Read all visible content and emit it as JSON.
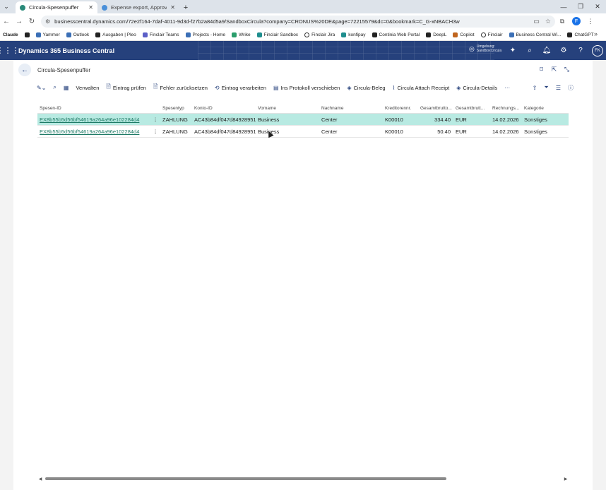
{
  "browser": {
    "tabs": [
      {
        "label": "Circula-Spesenpuffer",
        "active": true
      },
      {
        "label": "Expense export, Approve & Cu",
        "active": false
      }
    ],
    "url": "businesscentral.dynamics.com/72e2f164-7daf-4011-9d3d-f27b2a84d5a9/SandboxCircula?company=CRONUS%20DE&page=72215579&dc=0&bookmark=C_G-xNBACH3w",
    "profile_initial": "F",
    "bookmarks": [
      {
        "label": "Claude",
        "icon": "claude-icon"
      },
      {
        "label": "",
        "icon": "apps-grid-icon"
      },
      {
        "label": "Yammer",
        "icon": "yammer-icon"
      },
      {
        "label": "Outlook",
        "icon": "outlook-icon"
      },
      {
        "label": "Ausgaben | Pleo",
        "icon": "pleo-icon"
      },
      {
        "label": "Finclair Teams",
        "icon": "teams-icon"
      },
      {
        "label": "Projects - Home",
        "icon": "projects-icon"
      },
      {
        "label": "Wrike",
        "icon": "wrike-icon"
      },
      {
        "label": "Finclair Sandbox",
        "icon": "finclair-icon"
      },
      {
        "label": "Finclair Jira",
        "icon": "jira-icon"
      },
      {
        "label": "konfipay",
        "icon": "konfipay-icon"
      },
      {
        "label": "Continia Web Portal",
        "icon": "continia-icon"
      },
      {
        "label": "DeepL",
        "icon": "deepl-icon"
      },
      {
        "label": "Copilot",
        "icon": "copilot-icon"
      },
      {
        "label": "Finclair",
        "icon": "finclair-ring-icon"
      },
      {
        "label": "Business Central Wi...",
        "icon": "business-central-icon"
      },
      {
        "label": "ChatGPT",
        "icon": "chatgpt-icon"
      }
    ]
  },
  "app": {
    "title": "Dynamics 365 Business Central",
    "environment_line1": "Umgebung:",
    "environment_line2": "SandboxCircula",
    "user_initials": "FK"
  },
  "page": {
    "title": "Circula-Spesenpuffer"
  },
  "actions": [
    {
      "label": "Verwalten",
      "icon": ""
    },
    {
      "label": "Eintrag prüfen",
      "icon": "check-document-icon"
    },
    {
      "label": "Fehler zurücksetzen",
      "icon": "reset-document-icon"
    },
    {
      "label": "Eintrag verarbeiten",
      "icon": "process-icon"
    },
    {
      "label": "Ins Protokoll verschieben",
      "icon": "log-icon"
    },
    {
      "label": "Circula-Beleg",
      "icon": "circula-icon"
    },
    {
      "label": "Circula Attach Receipt",
      "icon": "paperclip-icon"
    },
    {
      "label": "Circula-Details",
      "icon": "circula-details-icon"
    }
  ],
  "table": {
    "columns": [
      "Spesen-ID",
      "",
      "Spesentyp",
      "Konto-ID",
      "Vorname",
      "Nachname",
      "Kreditorennr.",
      "Gesamtbrutto...",
      "Gesamtbrutt...",
      "Rechnungs...",
      "Kategorie"
    ],
    "rows": [
      {
        "id": "EX8b55b5d56bf54619a264a96e102284d4",
        "typ": "ZAHLUNG",
        "konto": "AC43b84df047d84928951...",
        "vorname": "Business",
        "nachname": "Center",
        "kreditor": "K00010",
        "betrag": "334.40",
        "waehrung": "EUR",
        "datum": "14.02.2026",
        "kategorie": "Sonstiges",
        "selected": true
      },
      {
        "id": "EX8b55b5d56bf54619a264a96e102284d4",
        "typ": "ZAHLUNG",
        "konto": "AC43b84df047d84928951...",
        "vorname": "Business",
        "nachname": "Center",
        "kreditor": "K00010",
        "betrag": "50.40",
        "waehrung": "EUR",
        "datum": "14.02.2026",
        "kategorie": "Sonstiges",
        "selected": false
      }
    ]
  },
  "colors": {
    "header_bg": "#26417c",
    "selected_row": "#b8eae2",
    "link": "#1f7a66"
  }
}
